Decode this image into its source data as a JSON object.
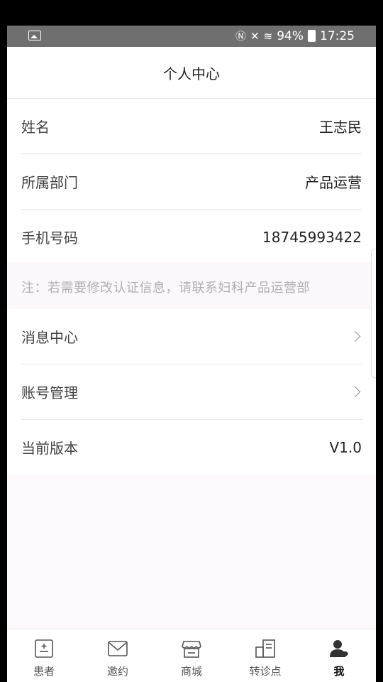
{
  "status_bar": {
    "battery": "94%",
    "time": "17:25"
  },
  "header": {
    "title": "个人中心"
  },
  "profile": {
    "name_label": "姓名",
    "name_value": "王志民",
    "dept_label": "所属部门",
    "dept_value": "产品运营",
    "phone_label": "手机号码",
    "phone_value": "18745993422"
  },
  "note": "注：若需要修改认证信息，请联系妇科产品运营部",
  "menu": {
    "messages": "消息中心",
    "account": "账号管理",
    "version_label": "当前版本",
    "version_value": "V1.0"
  },
  "tabs": [
    {
      "label": "患者",
      "icon": "patient-icon"
    },
    {
      "label": "邀约",
      "icon": "envelope-icon"
    },
    {
      "label": "商城",
      "icon": "store-icon"
    },
    {
      "label": "转诊点",
      "icon": "referral-icon"
    },
    {
      "label": "我",
      "icon": "user-icon",
      "active": true
    }
  ],
  "colors": {
    "background": "#fdf8fc",
    "accent_active": "#111111",
    "note_text": "#b0b0b0"
  }
}
